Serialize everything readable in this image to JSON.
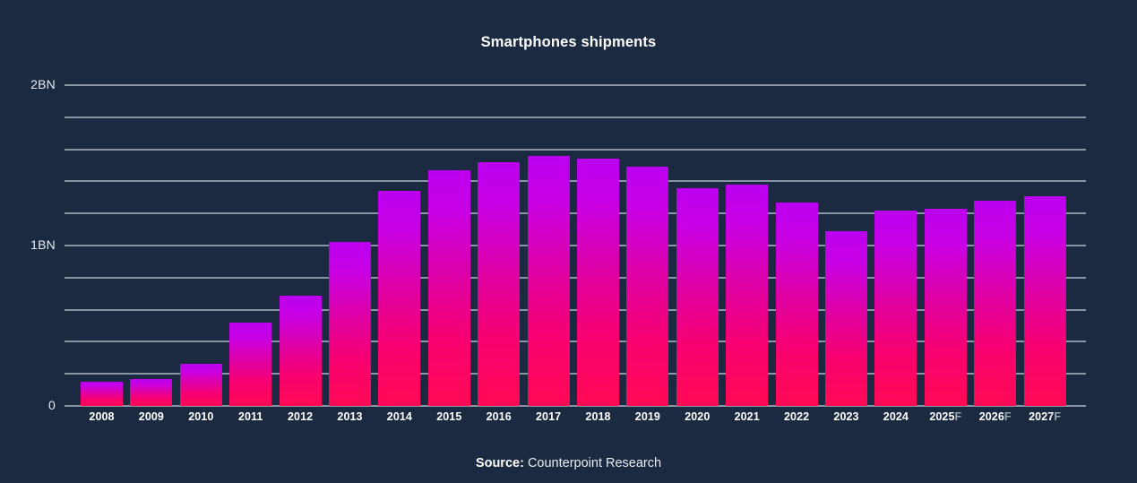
{
  "title": "Smartphones shipments",
  "source": {
    "label": "Source:",
    "value": "Counterpoint Research"
  },
  "colors": {
    "background": "#1b2a41",
    "gridline": "#8a95a3",
    "bar_top": "#bb00f0",
    "bar_bottom": "#ff0a55",
    "text": "#ffffff",
    "forecast_suffix": "#9aa5b2"
  },
  "axis": {
    "y_ticks": [
      "0",
      "1BN",
      "2BN"
    ],
    "y_tick_values": [
      0,
      1,
      2
    ],
    "y_min": 0,
    "y_max": 2,
    "gridline_count": 11,
    "gridline_step": 0.2,
    "unit": "BN"
  },
  "chart_data": {
    "type": "bar",
    "title": "Smartphones shipments",
    "xlabel": "",
    "ylabel": "",
    "ylim": [
      0,
      2
    ],
    "grid": true,
    "legend": "none",
    "unit": "billions of units",
    "categories": [
      "2008",
      "2009",
      "2010",
      "2011",
      "2012",
      "2013",
      "2014",
      "2015",
      "2016",
      "2017",
      "2018",
      "2019",
      "2020",
      "2021",
      "2022",
      "2023",
      "2024",
      "2025F",
      "2026F",
      "2027F"
    ],
    "values": [
      0.15,
      0.17,
      0.26,
      0.52,
      0.69,
      1.02,
      1.34,
      1.47,
      1.52,
      1.56,
      1.54,
      1.49,
      1.36,
      1.38,
      1.27,
      1.09,
      1.22,
      1.23,
      1.28,
      1.31
    ],
    "bars": [
      {
        "category": "2008",
        "label_year": "2008",
        "forecast_suffix": "",
        "value": 0.15,
        "forecast": false
      },
      {
        "category": "2009",
        "label_year": "2009",
        "forecast_suffix": "",
        "value": 0.17,
        "forecast": false
      },
      {
        "category": "2010",
        "label_year": "2010",
        "forecast_suffix": "",
        "value": 0.26,
        "forecast": false
      },
      {
        "category": "2011",
        "label_year": "2011",
        "forecast_suffix": "",
        "value": 0.52,
        "forecast": false
      },
      {
        "category": "2012",
        "label_year": "2012",
        "forecast_suffix": "",
        "value": 0.69,
        "forecast": false
      },
      {
        "category": "2013",
        "label_year": "2013",
        "forecast_suffix": "",
        "value": 1.02,
        "forecast": false
      },
      {
        "category": "2014",
        "label_year": "2014",
        "forecast_suffix": "",
        "value": 1.34,
        "forecast": false
      },
      {
        "category": "2015",
        "label_year": "2015",
        "forecast_suffix": "",
        "value": 1.47,
        "forecast": false
      },
      {
        "category": "2016",
        "label_year": "2016",
        "forecast_suffix": "",
        "value": 1.52,
        "forecast": false
      },
      {
        "category": "2017",
        "label_year": "2017",
        "forecast_suffix": "",
        "value": 1.56,
        "forecast": false
      },
      {
        "category": "2018",
        "label_year": "2018",
        "forecast_suffix": "",
        "value": 1.54,
        "forecast": false
      },
      {
        "category": "2019",
        "label_year": "2019",
        "forecast_suffix": "",
        "value": 1.49,
        "forecast": false
      },
      {
        "category": "2020",
        "label_year": "2020",
        "forecast_suffix": "",
        "value": 1.36,
        "forecast": false
      },
      {
        "category": "2021",
        "label_year": "2021",
        "forecast_suffix": "",
        "value": 1.38,
        "forecast": false
      },
      {
        "category": "2022",
        "label_year": "2022",
        "forecast_suffix": "",
        "value": 1.27,
        "forecast": false
      },
      {
        "category": "2023",
        "label_year": "2023",
        "forecast_suffix": "",
        "value": 1.09,
        "forecast": false
      },
      {
        "category": "2024",
        "label_year": "2024",
        "forecast_suffix": "",
        "value": 1.22,
        "forecast": false
      },
      {
        "category": "2025F",
        "label_year": "2025",
        "forecast_suffix": "F",
        "value": 1.23,
        "forecast": true
      },
      {
        "category": "2026F",
        "label_year": "2026",
        "forecast_suffix": "F",
        "value": 1.28,
        "forecast": true
      },
      {
        "category": "2027F",
        "label_year": "2027",
        "forecast_suffix": "F",
        "value": 1.31,
        "forecast": true
      }
    ]
  }
}
